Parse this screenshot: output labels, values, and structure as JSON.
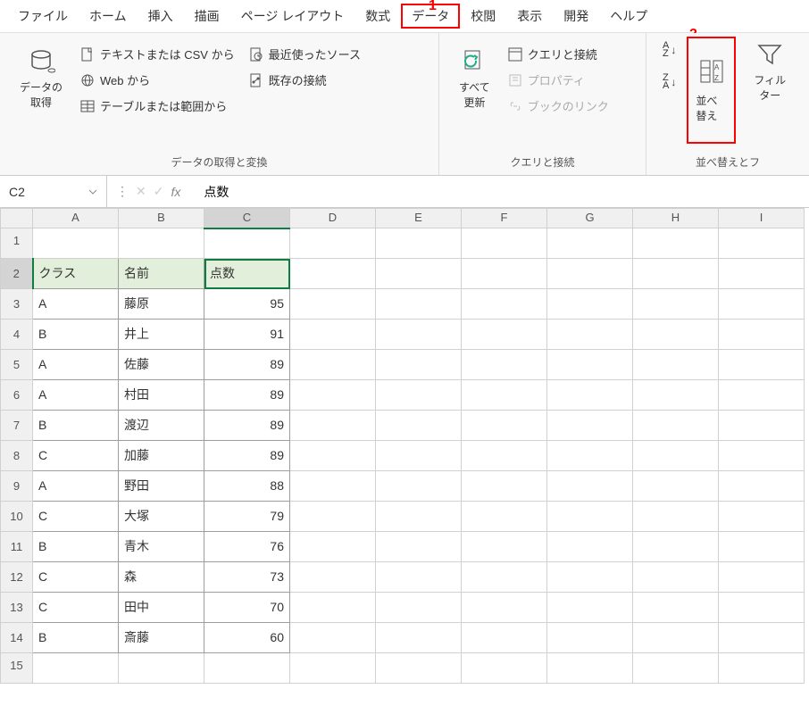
{
  "menu": {
    "file": "ファイル",
    "home": "ホーム",
    "insert": "挿入",
    "draw": "描画",
    "pageLayout": "ページ レイアウト",
    "formulas": "数式",
    "data": "データ",
    "review": "校閲",
    "view": "表示",
    "developer": "開発",
    "help": "ヘルプ"
  },
  "annotations": {
    "one": "1",
    "two": "2"
  },
  "ribbon": {
    "getData": {
      "label": "データの\n取得",
      "fromTextCsv": "テキストまたは CSV から",
      "fromWeb": "Web から",
      "fromTable": "テーブルまたは範囲から",
      "recentSources": "最近使ったソース",
      "existingConn": "既存の接続",
      "groupLabel": "データの取得と変換"
    },
    "queries": {
      "refreshAll": "すべて\n更新",
      "queriesConn": "クエリと接続",
      "properties": "プロパティ",
      "linksToBook": "ブックのリンク",
      "groupLabel": "クエリと接続"
    },
    "sort": {
      "asc": "A→Z",
      "desc": "Z→A",
      "custom": "並べ替え",
      "filter": "フィルター",
      "groupLabel": "並べ替えとフ"
    }
  },
  "formulaBar": {
    "nameBox": "C2",
    "value": "点数"
  },
  "columns": [
    "A",
    "B",
    "C",
    "D",
    "E",
    "F",
    "G",
    "H",
    "I"
  ],
  "rowNums": [
    "1",
    "2",
    "3",
    "4",
    "5",
    "6",
    "7",
    "8",
    "9",
    "10",
    "11",
    "12",
    "13",
    "14",
    "15"
  ],
  "table": {
    "headers": {
      "class": "クラス",
      "name": "名前",
      "score": "点数"
    },
    "rows": [
      {
        "class": "A",
        "name": "藤原",
        "score": "95"
      },
      {
        "class": "B",
        "name": "井上",
        "score": "91"
      },
      {
        "class": "A",
        "name": "佐藤",
        "score": "89"
      },
      {
        "class": "A",
        "name": "村田",
        "score": "89"
      },
      {
        "class": "B",
        "name": "渡辺",
        "score": "89"
      },
      {
        "class": "C",
        "name": "加藤",
        "score": "89"
      },
      {
        "class": "A",
        "name": "野田",
        "score": "88"
      },
      {
        "class": "C",
        "name": "大塚",
        "score": "79"
      },
      {
        "class": "B",
        "name": "青木",
        "score": "76"
      },
      {
        "class": "C",
        "name": "森",
        "score": "73"
      },
      {
        "class": "C",
        "name": "田中",
        "score": "70"
      },
      {
        "class": "B",
        "name": "斎藤",
        "score": "60"
      }
    ]
  },
  "selectedColumn": "C",
  "selectedRow": "2"
}
